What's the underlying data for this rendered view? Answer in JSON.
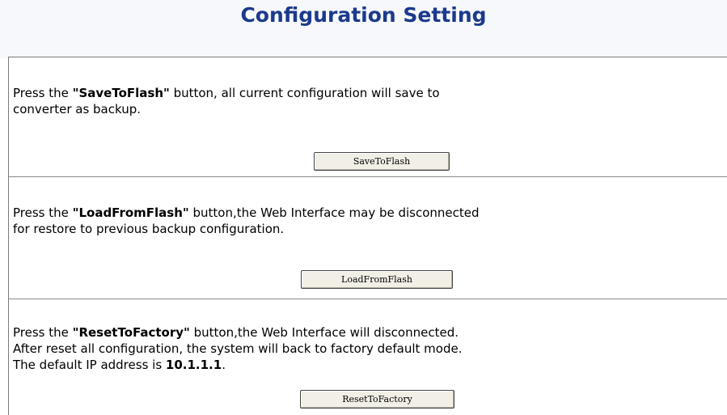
{
  "page": {
    "title": "Configuration Setting"
  },
  "sections": [
    {
      "prefix": "Press the ",
      "keyword": "\"SaveToFlash\"",
      "line1_rest": " button, all current configuration will save to",
      "line2": "converter as backup.",
      "button_label": "SaveToFlash"
    },
    {
      "prefix": "Press the ",
      "keyword": "\"LoadFromFlash\"",
      "line1_rest": " button,the Web Interface may be disconnected",
      "line2": "for restore to previous backup configuration.",
      "button_label": "LoadFromFlash"
    },
    {
      "prefix": "Press the ",
      "keyword": "\"ResetToFactory\"",
      "line1_rest": " button,the Web Interface will disconnected.",
      "line2": "After reset all configuration, the system will back to factory default mode.",
      "line3_prefix": "The default IP address is ",
      "default_ip": "10.1.1.1",
      "line3_suffix": ".",
      "button_label": "ResetToFactory"
    }
  ]
}
